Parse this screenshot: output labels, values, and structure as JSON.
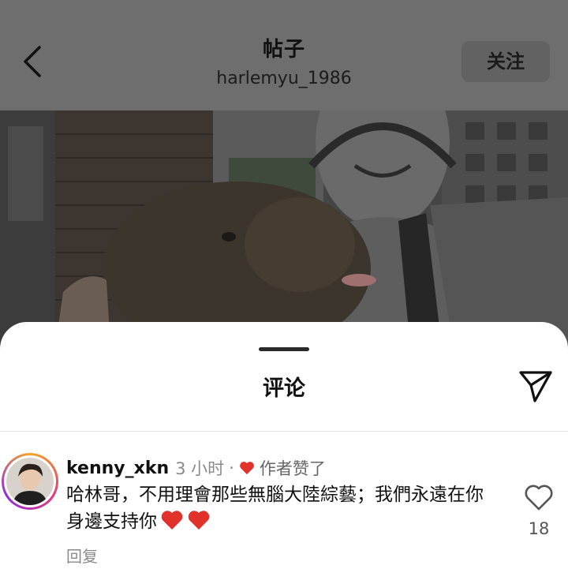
{
  "header": {
    "title": "帖子",
    "subtitle": "harlemyu_1986",
    "follow_label": "关注"
  },
  "sheet": {
    "title": "评论"
  },
  "comment": {
    "username": "kenny_xkn",
    "time": "3 小时",
    "separator": "·",
    "liked_by_author": "作者赞了",
    "text": "哈林哥，不用理會那些無腦大陸綜藝；我們永遠在你身邊支持你",
    "reply_label": "回复",
    "like_count": "18"
  },
  "colors": {
    "heart_red": "#e0312b",
    "header_bg": "#6e6e6e",
    "sheet_bg": "#ffffff"
  },
  "icons": {
    "back": "chevron-left-icon",
    "share": "send-icon",
    "like": "heart-outline-icon"
  }
}
